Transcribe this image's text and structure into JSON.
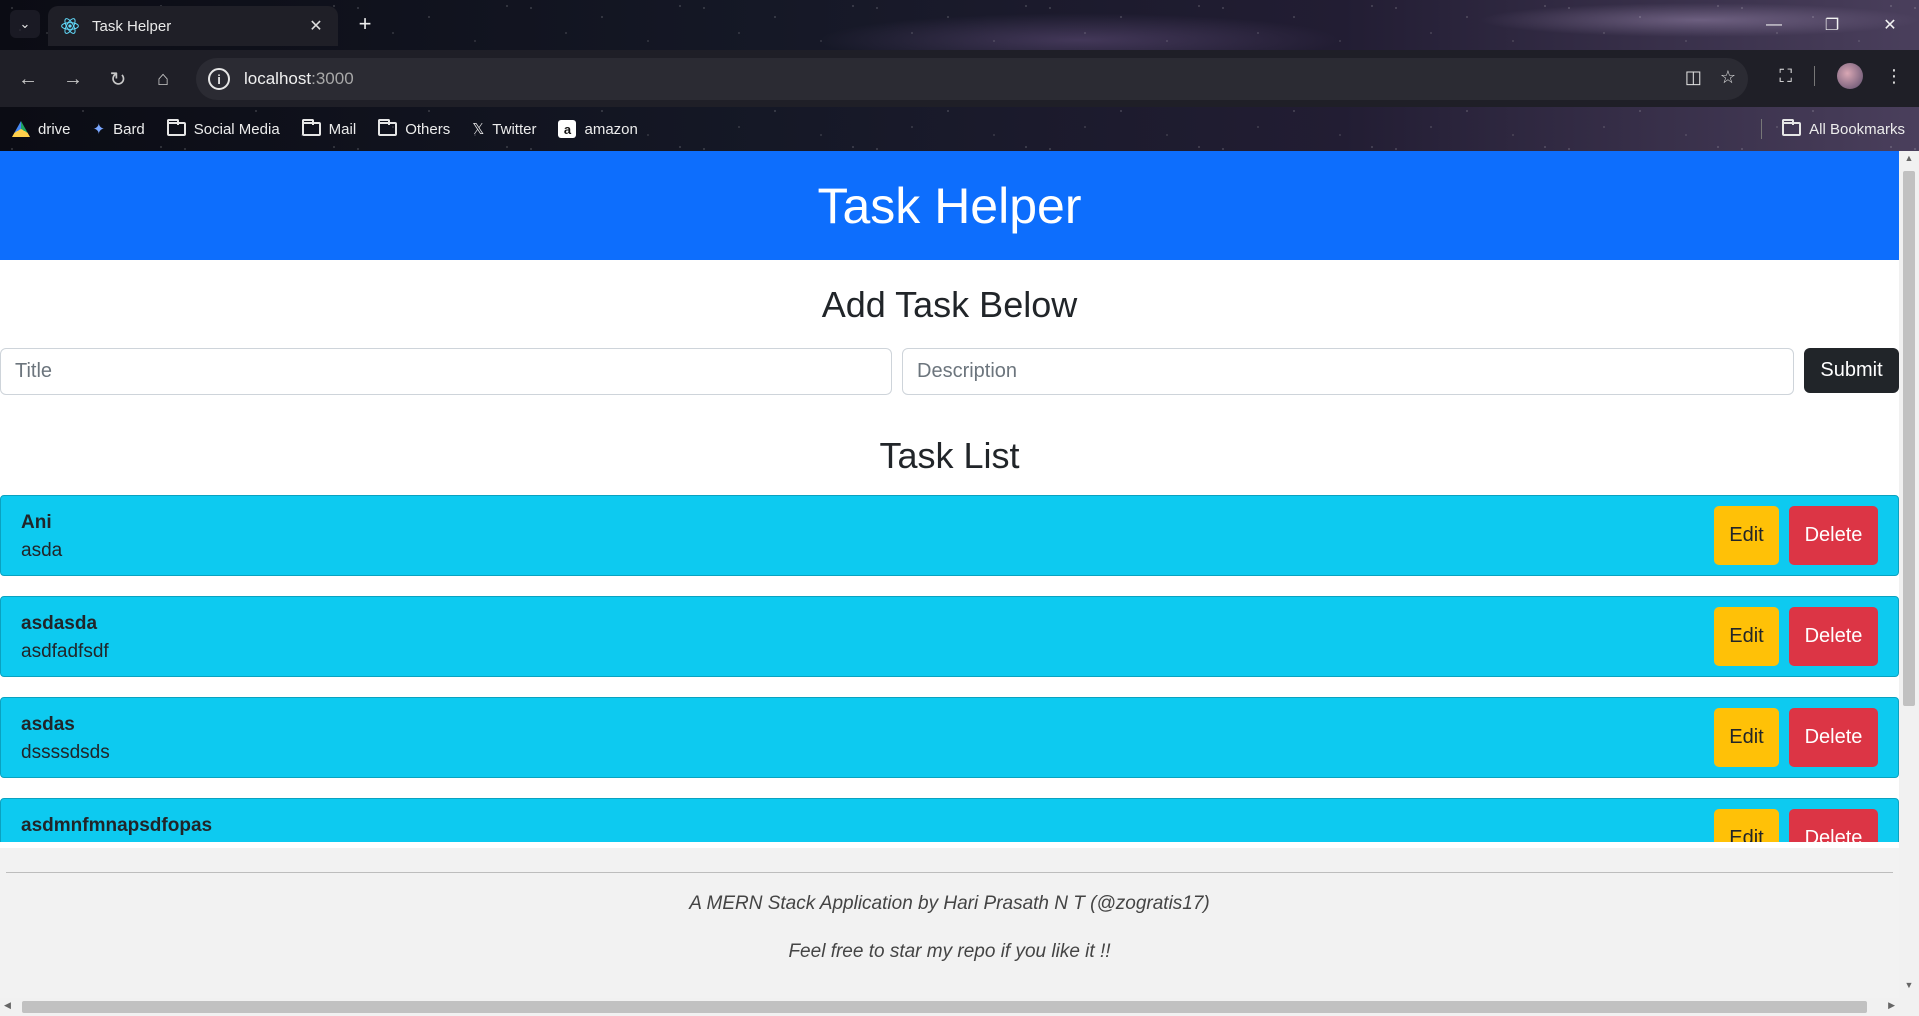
{
  "browser": {
    "tab_title": "Task Helper",
    "url_host": "localhost",
    "url_port": ":3000",
    "bookmarks": [
      {
        "label": "drive",
        "icon": "drive-icon"
      },
      {
        "label": "Bard",
        "icon": "bard-icon"
      },
      {
        "label": "Social Media",
        "icon": "folder-icon"
      },
      {
        "label": "Mail",
        "icon": "folder-icon"
      },
      {
        "label": "Others",
        "icon": "folder-icon"
      },
      {
        "label": "Twitter",
        "icon": "x-icon"
      },
      {
        "label": "amazon",
        "icon": "amazon-icon"
      }
    ],
    "all_bookmarks_label": "All Bookmarks"
  },
  "app": {
    "header_title": "Task Helper",
    "add_task_heading": "Add Task Below",
    "title_placeholder": "Title",
    "description_placeholder": "Description",
    "submit_label": "Submit",
    "task_list_heading": "Task List",
    "edit_label": "Edit",
    "delete_label": "Delete",
    "tasks": [
      {
        "title": "Ani",
        "description": "asda"
      },
      {
        "title": "asdasda",
        "description": "asdfadfsdf"
      },
      {
        "title": "asdas",
        "description": "dssssdsds"
      },
      {
        "title": "asdmnfmnapsdfopas",
        "description": ""
      }
    ],
    "footer_credit": "A MERN Stack Application by Hari Prasath N T (@zogratis17)",
    "footer_star": "Feel free to star my repo if you like it !!"
  },
  "colors": {
    "header": "#0d6efd",
    "task_card": "#0dcaf0",
    "edit_button": "#ffc107",
    "delete_button": "#dc3545",
    "submit_button": "#212529"
  }
}
